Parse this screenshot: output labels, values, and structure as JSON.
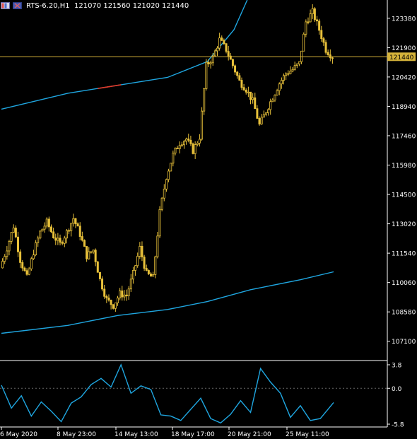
{
  "header": {
    "icon_left": "window-grid-icon",
    "icon_right": "flag-icon",
    "symbol": "RTS-6.20,H1",
    "ohlc": "121070 121560 121020 121440"
  },
  "colors": {
    "background": "#000000",
    "bull_candle": "#000000",
    "candle_border": "#e8c13a",
    "ma": "#1fa6e0",
    "ma_highlight": "#e03a2a",
    "price_line": "#d4b23a",
    "axis_text": "#ffffff",
    "oscillator": "#1fa6e0",
    "grid_line": "#666666"
  },
  "price_axis": {
    "ticks": [
      "123380",
      "121900",
      "120420",
      "118940",
      "117460",
      "115980",
      "114500",
      "113020",
      "111540",
      "110060",
      "108580",
      "107100"
    ],
    "current_price": "121440"
  },
  "oscillator_axis": {
    "ticks": [
      "3.8",
      "0.0",
      "-5.8"
    ]
  },
  "time_axis": {
    "labels": [
      "6 May 2020",
      "8 May 23:00",
      "14 May 13:00",
      "18 May 17:00",
      "20 May 21:00",
      "25 May 11:00"
    ]
  },
  "chart_data": {
    "type": "candlestick",
    "symbol": "RTS-6.20",
    "timeframe": "H1",
    "last": {
      "open": 121070,
      "high": 121560,
      "low": 121020,
      "close": 121440
    },
    "ylim": [
      106200,
      124300
    ],
    "close_path": [
      [
        0,
        110800
      ],
      [
        0.02,
        111800
      ],
      [
        0.04,
        112900
      ],
      [
        0.06,
        111200
      ],
      [
        0.08,
        110300
      ],
      [
        0.1,
        111600
      ],
      [
        0.12,
        112600
      ],
      [
        0.14,
        113100
      ],
      [
        0.16,
        112400
      ],
      [
        0.18,
        112000
      ],
      [
        0.2,
        112600
      ],
      [
        0.22,
        113300
      ],
      [
        0.24,
        112500
      ],
      [
        0.26,
        111400
      ],
      [
        0.28,
        111700
      ],
      [
        0.3,
        110200
      ],
      [
        0.32,
        109200
      ],
      [
        0.34,
        108900
      ],
      [
        0.36,
        109500
      ],
      [
        0.38,
        109400
      ],
      [
        0.4,
        110500
      ],
      [
        0.42,
        111800
      ],
      [
        0.44,
        110500
      ],
      [
        0.46,
        110300
      ],
      [
        0.48,
        113600
      ],
      [
        0.5,
        115400
      ],
      [
        0.52,
        116500
      ],
      [
        0.54,
        117100
      ],
      [
        0.56,
        117300
      ],
      [
        0.58,
        116700
      ],
      [
        0.6,
        117400
      ],
      [
        0.62,
        121000
      ],
      [
        0.64,
        121400
      ],
      [
        0.66,
        122300
      ],
      [
        0.68,
        121800
      ],
      [
        0.7,
        121000
      ],
      [
        0.72,
        120200
      ],
      [
        0.74,
        119800
      ],
      [
        0.76,
        119200
      ],
      [
        0.78,
        118000
      ],
      [
        0.8,
        118700
      ],
      [
        0.82,
        119400
      ],
      [
        0.84,
        120100
      ],
      [
        0.86,
        120600
      ],
      [
        0.88,
        120800
      ],
      [
        0.9,
        121100
      ],
      [
        0.92,
        123200
      ],
      [
        0.94,
        123700
      ],
      [
        0.96,
        122800
      ],
      [
        0.98,
        121800
      ],
      [
        1,
        121440
      ]
    ],
    "moving_average_upper": [
      [
        0,
        118800
      ],
      [
        0.2,
        119600
      ],
      [
        0.35,
        120000
      ],
      [
        0.5,
        120400
      ],
      [
        0.62,
        121200
      ],
      [
        0.7,
        122800
      ],
      [
        0.74,
        124300
      ]
    ],
    "moving_average_lower": [
      [
        0,
        107500
      ],
      [
        0.2,
        107900
      ],
      [
        0.35,
        108400
      ],
      [
        0.5,
        108700
      ],
      [
        0.62,
        109100
      ],
      [
        0.75,
        109700
      ],
      [
        0.9,
        110200
      ],
      [
        1,
        110600
      ]
    ],
    "oscillator_ylim": [
      -5.8,
      3.8
    ],
    "oscillator": [
      [
        0,
        0.5
      ],
      [
        0.03,
        -3.2
      ],
      [
        0.06,
        -1.2
      ],
      [
        0.09,
        -4.5
      ],
      [
        0.12,
        -2.2
      ],
      [
        0.15,
        -3.7
      ],
      [
        0.18,
        -5.4
      ],
      [
        0.21,
        -2.4
      ],
      [
        0.24,
        -1.4
      ],
      [
        0.27,
        0.6
      ],
      [
        0.3,
        1.6
      ],
      [
        0.33,
        0.2
      ],
      [
        0.36,
        3.8
      ],
      [
        0.39,
        -0.8
      ],
      [
        0.42,
        0.4
      ],
      [
        0.45,
        -0.2
      ],
      [
        0.48,
        -4.3
      ],
      [
        0.51,
        -4.5
      ],
      [
        0.54,
        -5.2
      ],
      [
        0.57,
        -3.4
      ],
      [
        0.6,
        -1.6
      ],
      [
        0.63,
        -4.9
      ],
      [
        0.66,
        -5.6
      ],
      [
        0.69,
        -4.2
      ],
      [
        0.72,
        -2.0
      ],
      [
        0.75,
        -3.9
      ],
      [
        0.78,
        3.2
      ],
      [
        0.81,
        1.0
      ],
      [
        0.84,
        -0.8
      ],
      [
        0.87,
        -4.7
      ],
      [
        0.9,
        -2.8
      ],
      [
        0.93,
        -5.2
      ],
      [
        0.96,
        -4.9
      ],
      [
        1,
        -2.3
      ]
    ]
  }
}
